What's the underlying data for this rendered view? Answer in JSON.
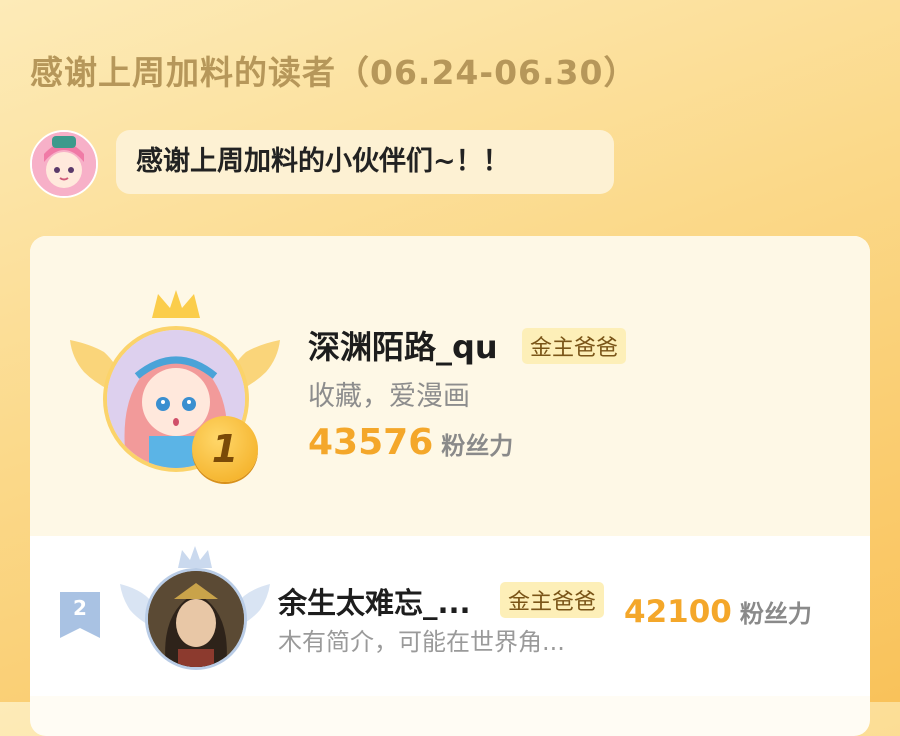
{
  "header": {
    "title": "感谢上周加料的读者（06.24-06.30）"
  },
  "message": {
    "text": "感谢上周加料的小伙伴们~！！"
  },
  "ranking": [
    {
      "rank": "1",
      "name": "深渊陌路_qu",
      "badge": "金主爸爸",
      "bio": "收藏，爱漫画",
      "fans": "43576",
      "fans_unit": "粉丝力"
    },
    {
      "rank": "2",
      "name": "余生太难忘_...",
      "badge": "金主爸爸",
      "bio": "木有简介，可能在世界角...",
      "fans": "42100",
      "fans_unit": "粉丝力"
    }
  ],
  "colors": {
    "accent": "#f4a72a",
    "badge_bg": "#fdefb8",
    "gold": "#fbd36a"
  }
}
